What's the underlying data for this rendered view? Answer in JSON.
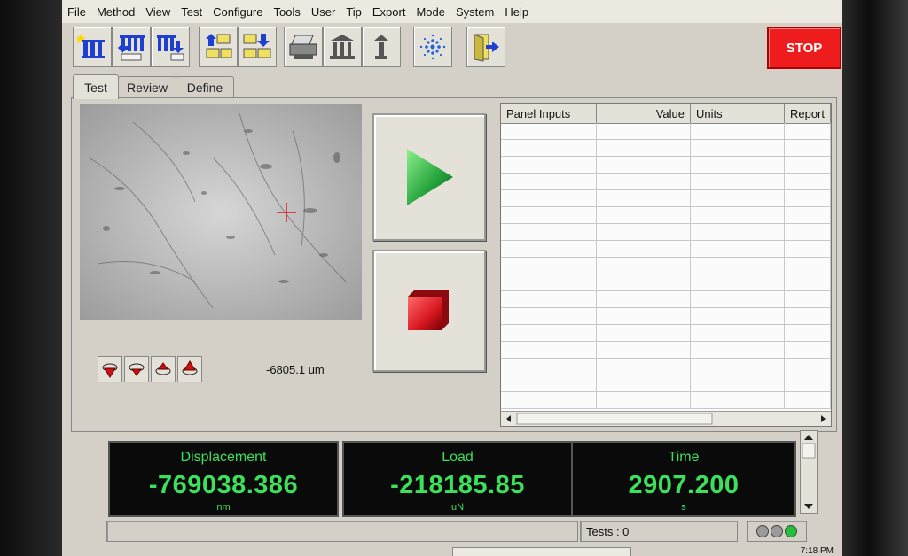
{
  "menu": [
    "File",
    "Method",
    "View",
    "Test",
    "Configure",
    "Tools",
    "User",
    "Tip",
    "Export",
    "Mode",
    "System",
    "Help"
  ],
  "toolbar": {
    "stop_label": "STOP",
    "icons": [
      "new-method-icon",
      "open-method-icon",
      "save-method-icon",
      "move-up-icon",
      "move-down-icon",
      "print-icon",
      "column-icon",
      "single-column-icon",
      "agilent-logo-icon",
      "exit-icon"
    ]
  },
  "tabs": [
    "Test",
    "Review",
    "Define"
  ],
  "camera": {
    "position_readout": "-6805.1 um"
  },
  "table": {
    "headers": [
      "Panel Inputs",
      "Value",
      "Units",
      "Report"
    ]
  },
  "readouts": [
    {
      "label": "Displacement",
      "value": "-769038.386",
      "unit": "nm"
    },
    {
      "label": "Load",
      "value": "-218185.85",
      "unit": "uN"
    },
    {
      "label": "Time",
      "value": "2907.200",
      "unit": "s"
    }
  ],
  "status": {
    "tests_label": "Tests : 0",
    "clock": "7:18 PM",
    "indicator_colors": [
      "#9a9a9a",
      "#9a9a9a",
      "#21c23a"
    ]
  },
  "colors": {
    "readout_text": "#3de05a",
    "stop_button": "#ee1c1c"
  }
}
